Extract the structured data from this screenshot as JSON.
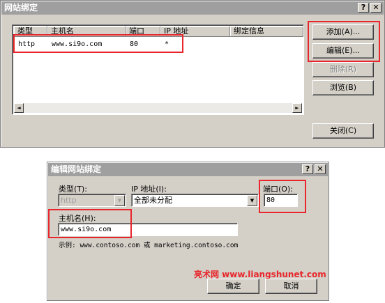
{
  "bindings_dialog": {
    "title": "网站绑定",
    "title_buttons": {
      "help": "?",
      "close": "✕"
    },
    "columns": [
      "类型",
      "主机名",
      "端口",
      "IP 地址",
      "绑定信息"
    ],
    "rows": [
      {
        "type": "http",
        "host": "www.si9o.com",
        "port": "80",
        "ip": "*",
        "info": ""
      }
    ],
    "buttons": {
      "add": "添加(A)...",
      "edit": "编辑(E)...",
      "remove": "删除(R)",
      "browse": "浏览(B)",
      "close": "关闭(C)"
    },
    "scroll_left": "◄",
    "scroll_right": "►"
  },
  "edit_dialog": {
    "title": "编辑网站绑定",
    "title_buttons": {
      "help": "?",
      "close": "✕"
    },
    "type_label": "类型(T):",
    "type_value": "http",
    "ip_label": "IP 地址(I):",
    "ip_value": "全部未分配",
    "port_label": "端口(O):",
    "port_value": "80",
    "host_label": "主机名(H):",
    "host_value": "www.si9o.com",
    "example": "示例: www.contoso.com 或 marketing.contoso.com",
    "dropdown_arrow": "▼",
    "ok": "确定",
    "cancel": "取消"
  },
  "watermark": "亮术网 www.liangshunet.com",
  "colors": {
    "highlight_red": "#e8262b",
    "dialog_bg": "#d4d0c8",
    "titlebar_inactive": "#9f9f9f"
  }
}
